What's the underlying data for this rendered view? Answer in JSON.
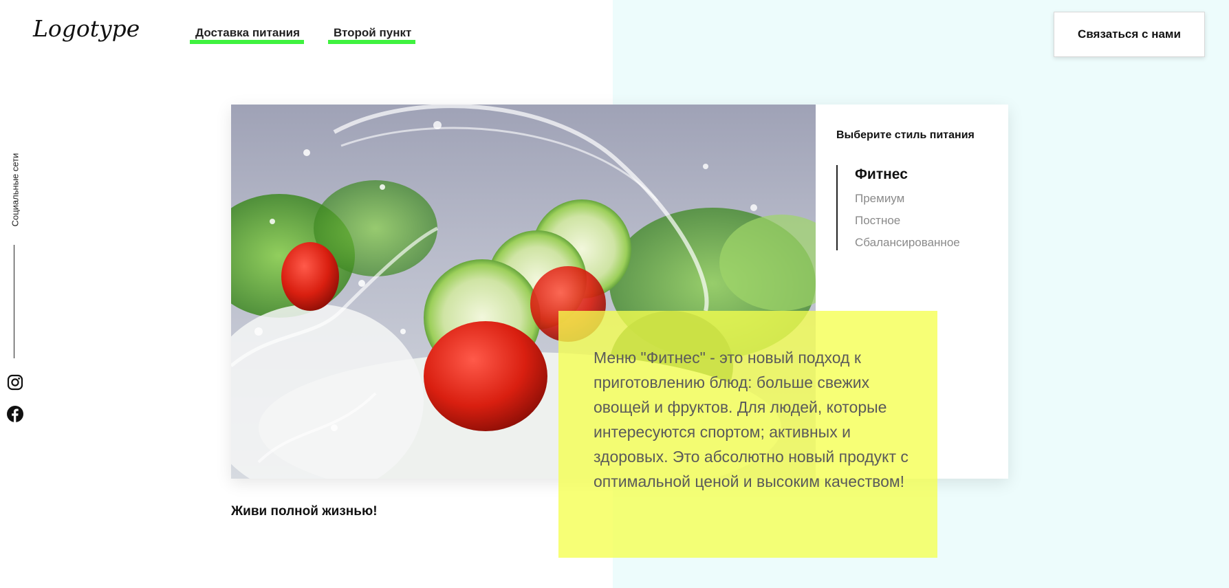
{
  "header": {
    "logo": "Logotype",
    "nav": [
      {
        "label": "Доставка питания"
      },
      {
        "label": "Второй пункт"
      }
    ],
    "contact_button": "Связаться с нами"
  },
  "sidebar": {
    "social_label": "Социальные сети",
    "icons": [
      "instagram-icon",
      "facebook-icon"
    ]
  },
  "hero": {
    "image": "salad-water-splash-photo",
    "panel_title": "Выберите стиль питания",
    "styles": [
      {
        "label": "Фитнес",
        "active": true
      },
      {
        "label": "Премиум",
        "active": false
      },
      {
        "label": "Постное",
        "active": false
      },
      {
        "label": "Сбалансированное",
        "active": false
      }
    ],
    "description": "Меню \"Фитнес\" - это новый подход к приготовлению блюд: больше свежих овощей и фруктов. Для людей, которые интересуются спортом; активных и здоровых. Это абсолютно новый продукт с оптимальной ценой и высоким качеством!",
    "tagline": "Живи полной жизнью!"
  },
  "colors": {
    "accent_underline": "#3ff23f",
    "right_background": "#edfcfc",
    "highlight_box": "#f5ff50"
  }
}
